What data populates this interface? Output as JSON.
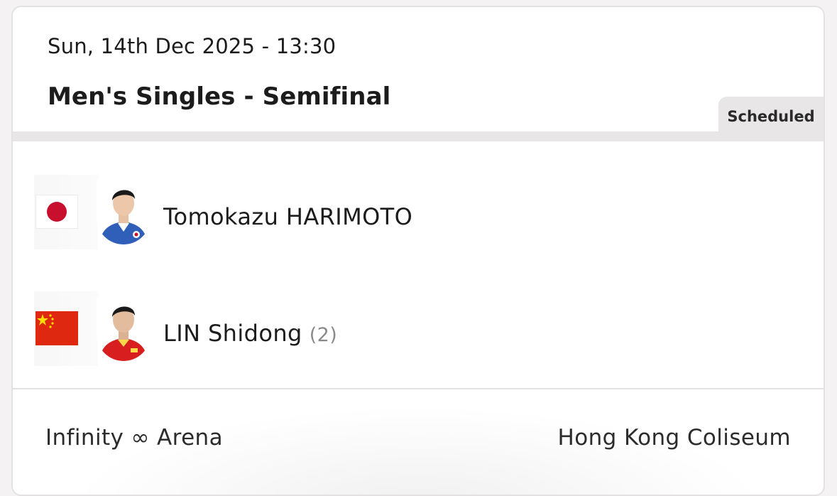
{
  "match": {
    "datetime": "Sun, 14th Dec 2025 - 13:30",
    "event": "Men's Singles - Semifinal",
    "status": "Scheduled"
  },
  "players": [
    {
      "name": "Tomokazu HARIMOTO",
      "seed": "",
      "flag_icon": "japan-flag-icon",
      "colors": {
        "flag_primary": "#c8102e",
        "jersey": "#2f5fb8"
      }
    },
    {
      "name": "LIN Shidong",
      "seed": "(2)",
      "flag_icon": "china-flag-icon",
      "colors": {
        "flag_primary": "#de2910",
        "jersey": "#d81e1e"
      }
    }
  ],
  "footer": {
    "table": "Infinity ∞ Arena",
    "venue": "Hong Kong Coliseum"
  }
}
